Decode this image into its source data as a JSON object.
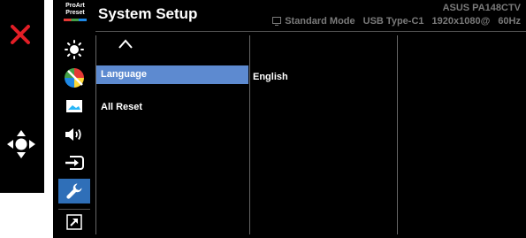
{
  "colors": {
    "background": "#000000",
    "exit_red": "#e21e26",
    "active_icon_bg": "#2f6fb8",
    "selected_item_bg": "#5d8ad0",
    "muted_text": "#7a7a7a",
    "nav_icon": "#ffffff"
  },
  "controls": {
    "exit": {
      "icon": "close-icon",
      "color": "#e21e26"
    },
    "navigate": {
      "icon": "five-way-joystick-icon"
    }
  },
  "header": {
    "preset_badge": {
      "line1": "ProArt",
      "line2": "Preset"
    },
    "title": "System Setup",
    "model": "ASUS PA148CTV",
    "status": {
      "mode": "Standard Mode",
      "input": "USB Type-C1",
      "resolution": "1920x1080@",
      "refresh": "60Hz"
    }
  },
  "menu_icons": [
    {
      "name": "brightness-icon",
      "active": false
    },
    {
      "name": "color-icon",
      "active": false
    },
    {
      "name": "image-icon",
      "active": false
    },
    {
      "name": "sound-icon",
      "active": false
    },
    {
      "name": "input-select-icon",
      "active": false
    },
    {
      "name": "wrench-icon",
      "active": true
    },
    {
      "name": "shortcut-icon",
      "active": false
    }
  ],
  "submenu": {
    "items": [
      {
        "label": "Language",
        "selected": true
      },
      {
        "label": "All Reset",
        "selected": false
      }
    ]
  },
  "values": {
    "language_value": "English"
  }
}
